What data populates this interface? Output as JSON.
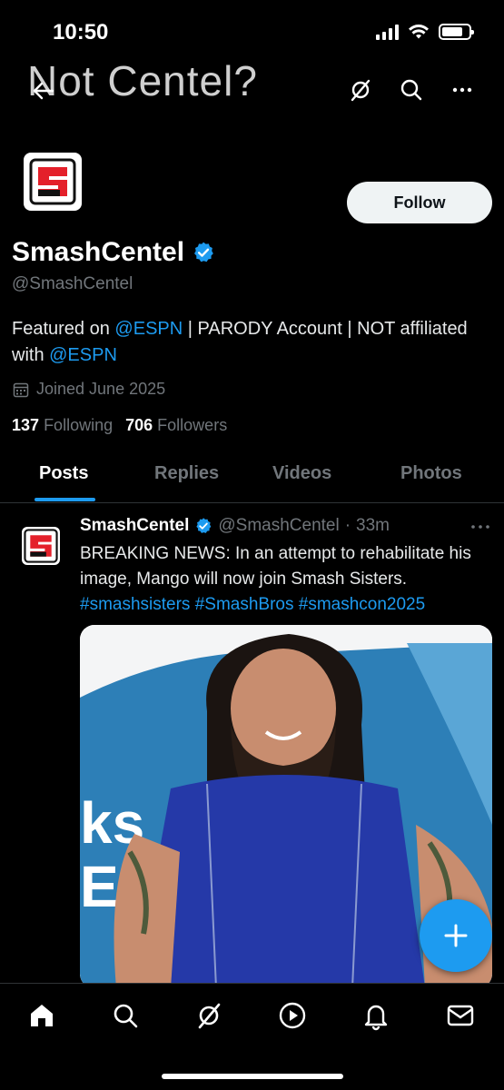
{
  "status_bar": {
    "time": "10:50"
  },
  "header": {
    "title": "Not Centel?"
  },
  "profile": {
    "follow_label": "Follow",
    "display_name": "SmashCentel",
    "handle": "@SmashCentel",
    "bio_prefix": "Featured on ",
    "bio_mention_1": "@ESPN",
    "bio_middle": " | PARODY Account | NOT affiliated with ",
    "bio_mention_2": "@ESPN",
    "joined": "Joined June 2025",
    "following_count": "137",
    "following_label": "Following",
    "followers_count": "706",
    "followers_label": "Followers"
  },
  "tabs": [
    {
      "label": "Posts"
    },
    {
      "label": "Replies"
    },
    {
      "label": "Videos"
    },
    {
      "label": "Photos"
    }
  ],
  "post": {
    "name": "SmashCentel",
    "handle": "@SmashCentel",
    "separator": "·",
    "time": "33m",
    "text": "BREAKING NEWS: In an attempt to rehabilitate his image, Mango will now join Smash Sisters.",
    "hashtags": "#smashsisters #SmashBros #smashcon2025",
    "media_overlay_text": "ks\nES"
  },
  "colors": {
    "accent": "#1d9bf0",
    "brand_red": "#e4202a",
    "background": "#000000"
  },
  "icons": [
    "back-arrow-icon",
    "grok-icon",
    "search-icon",
    "more-icon",
    "verified-icon",
    "calendar-icon",
    "plus-icon",
    "home-icon",
    "explore-icon",
    "grok-nav-icon",
    "video-icon",
    "notifications-icon",
    "messages-icon"
  ]
}
